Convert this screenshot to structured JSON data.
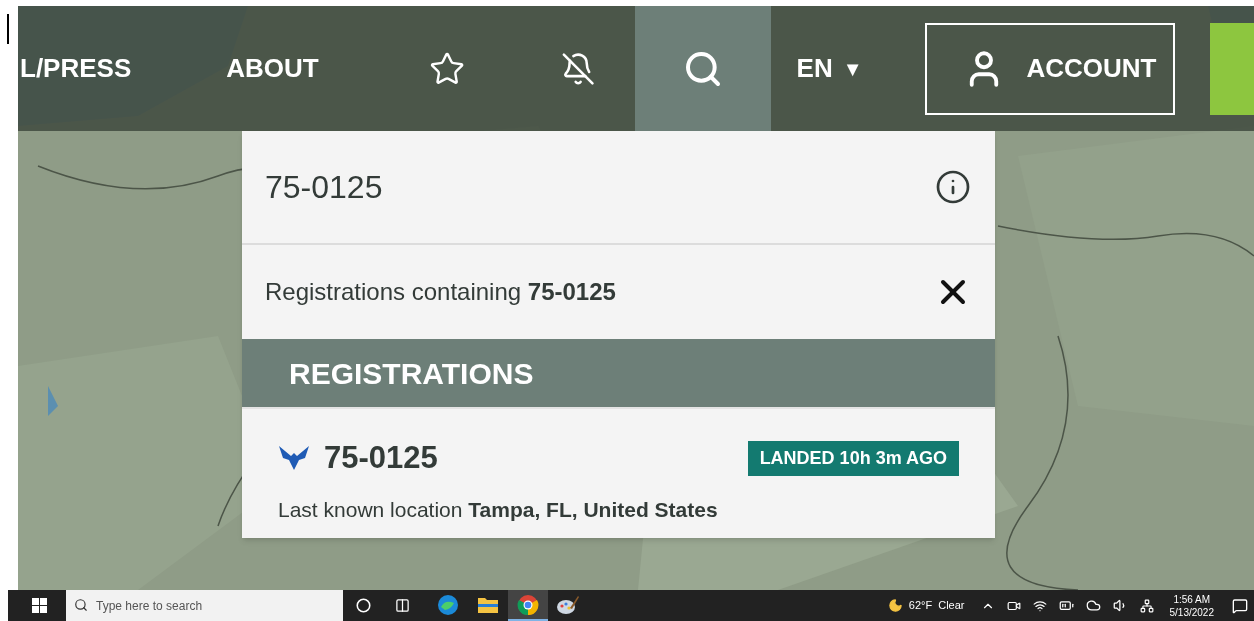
{
  "nav": {
    "items": [
      {
        "label": "L/PRESS"
      },
      {
        "label": "ABOUT"
      }
    ],
    "search_button": {
      "selected": true
    },
    "language": {
      "label": "EN",
      "caret": "▼"
    },
    "account": {
      "label": "ACCOUNT"
    }
  },
  "search": {
    "value": "75-0125",
    "suggestion": "Registrations containing **75-0125**",
    "section_title": "REGISTRATIONS",
    "results": [
      {
        "registration": "75-0125",
        "status": "LANDED 10h 3m AGO",
        "location": "Last known location **Tampa, FL, United States**"
      }
    ]
  },
  "taskbar": {
    "search_placeholder": "Type here to search",
    "apps": [
      {
        "kind": "edge",
        "selected": false
      },
      {
        "kind": "explorer",
        "selected": false
      },
      {
        "kind": "chrome",
        "selected": true
      },
      {
        "kind": "paint",
        "selected": false
      }
    ],
    "weather": {
      "temperature": "62°F",
      "condition": "Clear"
    },
    "time": "1:56 AM",
    "date": "5/13/2022"
  }
}
